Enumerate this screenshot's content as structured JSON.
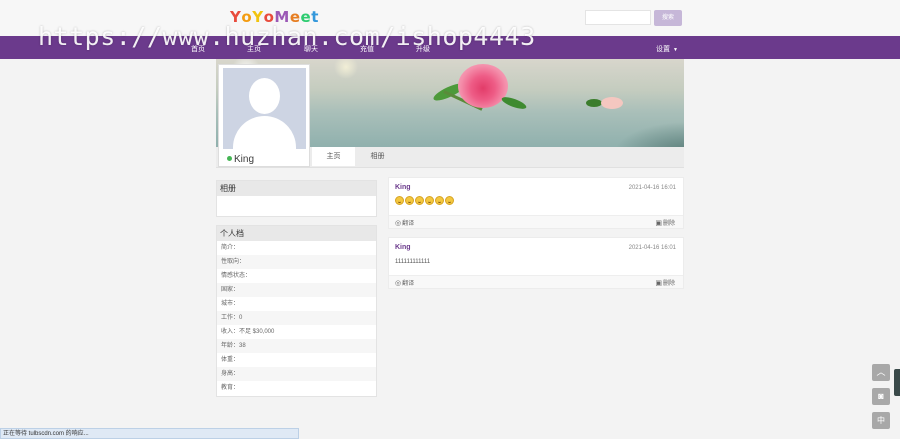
{
  "header": {
    "logo_letters": [
      {
        "ch": "Y",
        "color": "#e84b3c"
      },
      {
        "ch": "o",
        "color": "#f39c12"
      },
      {
        "ch": "Y",
        "color": "#f1c40f"
      },
      {
        "ch": "o",
        "color": "#e84b3c"
      },
      {
        "ch": "M",
        "color": "#9b59b6"
      },
      {
        "ch": "e",
        "color": "#e67e22"
      },
      {
        "ch": "e",
        "color": "#2ecc71"
      },
      {
        "ch": "t",
        "color": "#3498db"
      }
    ],
    "search_button": "搜索",
    "search_placeholder": ""
  },
  "nav": {
    "items": [
      "首页",
      "主页",
      "聊天",
      "充值",
      "升级"
    ],
    "settings": "设置",
    "color": "#6b3a8c"
  },
  "watermark": "https://www.huzhan.com/ishop4443",
  "profile": {
    "username": "King",
    "online": true,
    "tabs": [
      "主页",
      "相册"
    ],
    "active_tab": 0
  },
  "album_panel": {
    "title": "相册"
  },
  "info_panel": {
    "title": "个人档",
    "rows": [
      "简介：",
      "性取向：",
      "情感状态：",
      "国家：",
      "城市：",
      "工作：0",
      "收入：不足 $30,000",
      "年龄：38",
      "体重：",
      "身高：",
      "教育："
    ]
  },
  "posts": [
    {
      "author": "King",
      "time": "2021-04-16 16:01",
      "content": "",
      "smiley_count": 6,
      "share": "翻译",
      "delete": "删除"
    },
    {
      "author": "King",
      "time": "2021-04-16 16:01",
      "content": "111111111111",
      "smiley_count": 0,
      "share": "翻译",
      "delete": "删除"
    }
  ],
  "float_buttons": {
    "top": "︿",
    "camera": "◙",
    "lang": "中"
  },
  "statusbar": "正在等待 tulbscdn.com 的响应..."
}
